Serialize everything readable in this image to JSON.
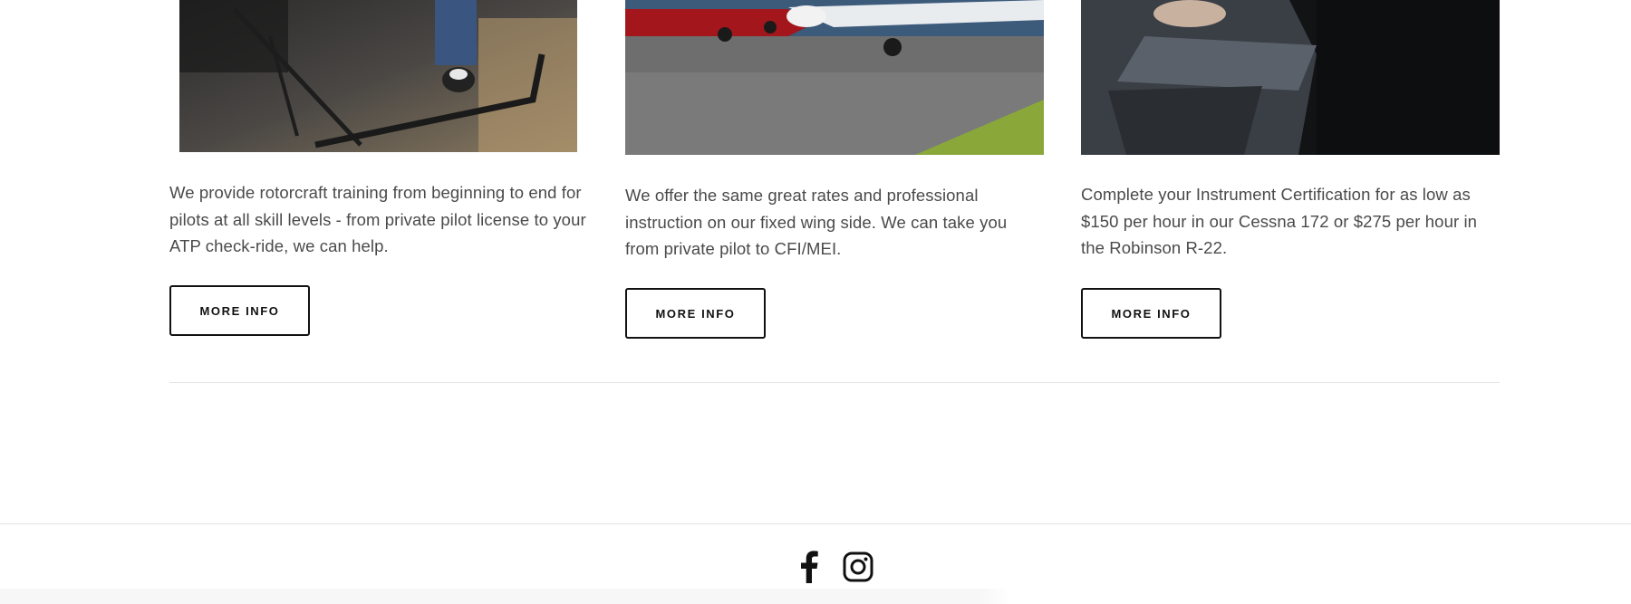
{
  "cards": [
    {
      "image_alt": "helicopter-skid-photo",
      "description": "We provide rotorcraft training from beginning to end for pilots at all skill levels -  from private pilot license to your ATP check-ride, we can help.",
      "button_label": "MORE INFO"
    },
    {
      "image_alt": "airplane-on-tarmac-photo",
      "description": "We offer the same great rates and professional instruction on our fixed wing side.  We can take you from private pilot to CFI/MEI.",
      "button_label": "MORE INFO"
    },
    {
      "image_alt": "cockpit-instrument-photo",
      "description": "Complete your Instrument Certification for as low as $150 per hour in our Cessna 172 or $275 per hour in the Robinson R-22.",
      "button_label": "MORE INFO"
    }
  ],
  "footer": {
    "social_icons": [
      "facebook-icon",
      "instagram-icon"
    ]
  },
  "colors": {
    "text": "#4a4a4a",
    "button_border": "#111111",
    "rule": "#e3e3e3"
  }
}
